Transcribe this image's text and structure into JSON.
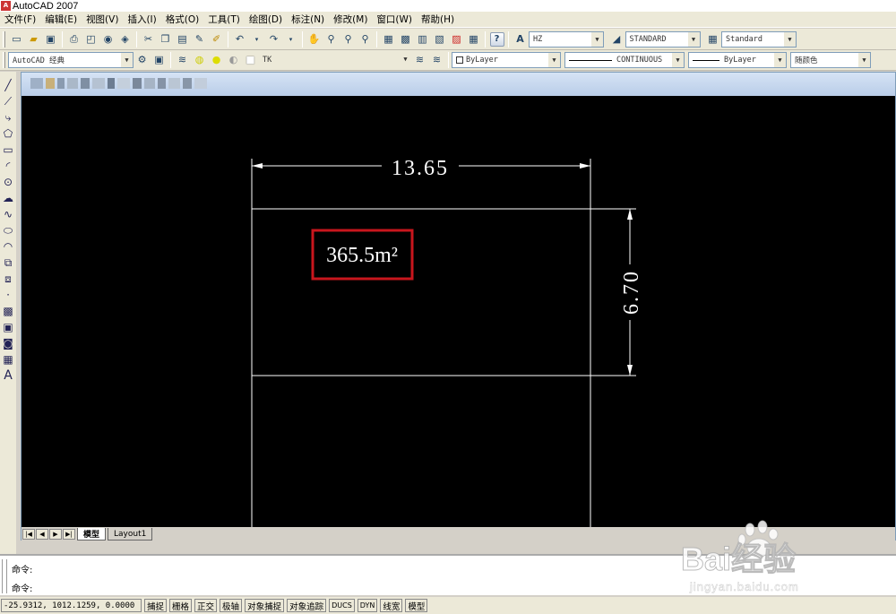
{
  "window": {
    "title": "AutoCAD 2007"
  },
  "menu": [
    "文件(F)",
    "编辑(E)",
    "视图(V)",
    "插入(I)",
    "格式(O)",
    "工具(T)",
    "绘图(D)",
    "标注(N)",
    "修改(M)",
    "窗口(W)",
    "帮助(H)"
  ],
  "toolbar1": {
    "text_style": "HZ",
    "dim_style": "STANDARD",
    "table_style": "Standard"
  },
  "toolbar2": {
    "workspace": "AutoCAD 经典",
    "layer": "TK",
    "color": "ByLayer",
    "linetype": "CONTINUOUS",
    "lineweight": "ByLayer",
    "plot_style": "随颜色"
  },
  "drawing": {
    "width_dimension": "13.65",
    "height_dimension": "6.70",
    "area_label": "365.5m²",
    "highlight_color": "#c8161d"
  },
  "tabs": [
    "模型",
    "Layout1"
  ],
  "command": {
    "line1": "命令:",
    "line2": "命令:"
  },
  "status": {
    "coordinates": "-25.9312, 1012.1259, 0.0000",
    "buttons": [
      "捕捉",
      "栅格",
      "正交",
      "极轴",
      "对象捕捉",
      "对象追踪",
      "DUCS",
      "DYN",
      "线宽",
      "模型"
    ]
  },
  "watermark": {
    "brand": "Bai经验",
    "url": "jingyan.baidu.com"
  }
}
